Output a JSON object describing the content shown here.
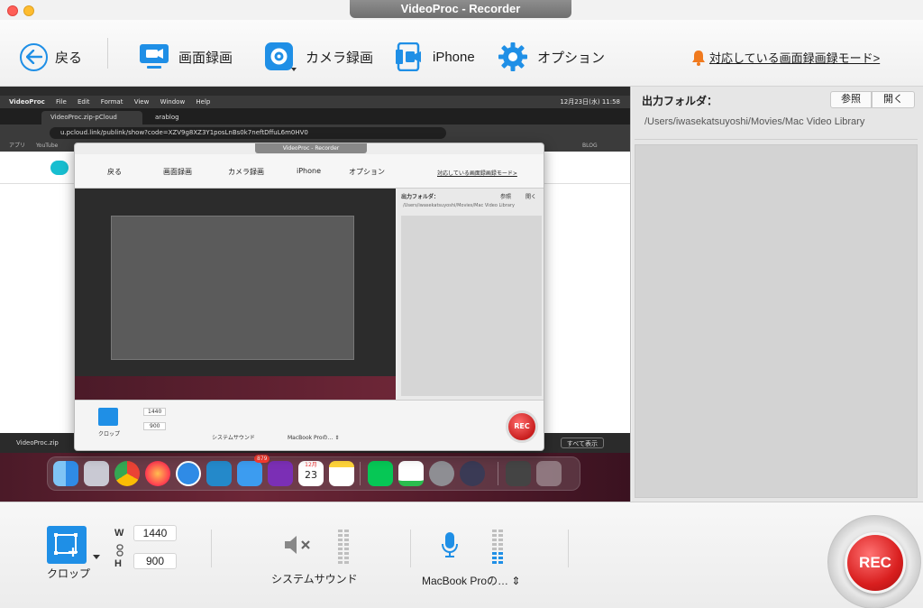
{
  "window": {
    "title": "VideoProc - Recorder"
  },
  "toolbar": {
    "back_label": "戻る",
    "screen_label": "画面録画",
    "camera_label": "カメラ録画",
    "iphone_label": "iPhone",
    "option_label": "オプション",
    "notice_label": "対応している画面録画録モード>",
    "accent": "#1f8fe6"
  },
  "output": {
    "label": "出力フォルダ：",
    "browse_label": "参照",
    "open_label": "開く",
    "path": "/Users/iwasekatsuyoshi/Movies/Mac Video Library"
  },
  "preview": {
    "menubar_app": "VideoProc",
    "menubar_items": [
      "File",
      "Edit",
      "Format",
      "View",
      "Window",
      "Help"
    ],
    "clock": "12月23日(水) 11:58",
    "tab_active": "VideoProc.zip-pCloud",
    "tab_other": "arablog",
    "url": "u.pcloud.link/publink/show?code=XZV9g8XZ3Y1posLnBs0k7neftDffuL6m0HV0",
    "bookmarks": [
      "アプリ",
      "YouTube"
    ],
    "bookmark_right": "BLOG",
    "download_file": "VideoProc.zip",
    "show_all": "すべて表示",
    "mail_badge": "879",
    "calendar_month": "12月",
    "calendar_day": "23",
    "nested": {
      "title": "VideoProc - Recorder",
      "back": "戻る",
      "screen": "画面録画",
      "camera": "カメラ録画",
      "iphone": "iPhone",
      "option": "オプション",
      "notice": "対応している画面録画録モード>",
      "output_label": "出力フォルダ：",
      "browse": "参照",
      "open": "開く",
      "path": "/Users/iwasekatsuyoshi/Movies/Mac Video Library",
      "crop": "クロップ",
      "w": "1440",
      "h": "900",
      "sys": "システムサウンド",
      "mic": "MacBook Proの… ⇕",
      "rec": "REC"
    }
  },
  "controls": {
    "crop_label": "クロップ",
    "w_label": "W",
    "h_label": "H",
    "width_value": "1440",
    "height_value": "900",
    "system_sound_label": "システムサウンド",
    "mic_label": "MacBook Proの… ⇕",
    "rec_label": "REC"
  }
}
